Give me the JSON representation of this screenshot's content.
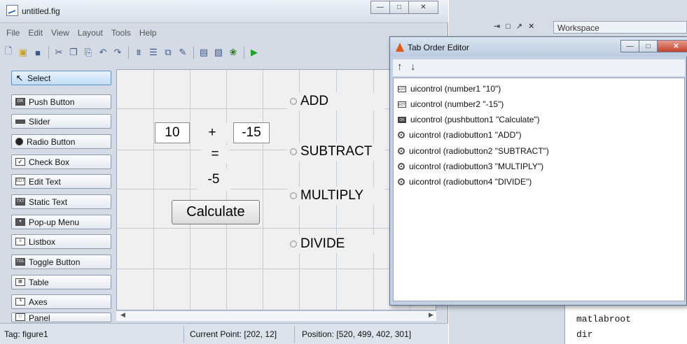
{
  "guide": {
    "title": "untitled.fig",
    "menu": [
      "File",
      "Edit",
      "View",
      "Layout",
      "Tools",
      "Help"
    ],
    "palette": [
      {
        "label": "Select",
        "icon": "arrow-cursor-icon"
      },
      {
        "label": "Push Button",
        "icon": "push-button-icon"
      },
      {
        "label": "Slider",
        "icon": "slider-icon"
      },
      {
        "label": "Radio Button",
        "icon": "radio-button-icon"
      },
      {
        "label": "Check Box",
        "icon": "check-box-icon"
      },
      {
        "label": "Edit Text",
        "icon": "edit-text-icon"
      },
      {
        "label": "Static Text",
        "icon": "static-text-icon"
      },
      {
        "label": "Pop-up Menu",
        "icon": "popup-menu-icon"
      },
      {
        "label": "Listbox",
        "icon": "listbox-icon"
      },
      {
        "label": "Toggle Button",
        "icon": "toggle-button-icon"
      },
      {
        "label": "Table",
        "icon": "table-icon"
      },
      {
        "label": "Axes",
        "icon": "axes-icon"
      },
      {
        "label": "Panel",
        "icon": "panel-icon"
      }
    ],
    "canvas": {
      "number1": "10",
      "plus": "+",
      "number2": "-15",
      "equals": "=",
      "result": "-5",
      "calculate": "Calculate",
      "radios": [
        "ADD",
        "SUBTRACT",
        "MULTIPLY",
        "DIVIDE"
      ]
    },
    "status": {
      "tag": "Tag: figure1",
      "current_point": "Current Point:  [202, 12]",
      "position": "Position: [520, 499, 402, 301]"
    }
  },
  "desktop": {
    "workspace_label": "Workspace",
    "command_history": [
      "matlabroot",
      "dir"
    ]
  },
  "tab_order_editor": {
    "title": "Tab Order Editor",
    "items": [
      {
        "text": "uicontrol (number1 \"10\")",
        "icon": "edit-text-icon"
      },
      {
        "text": "uicontrol (number2 \"-15\")",
        "icon": "edit-text-icon"
      },
      {
        "text": "uicontrol (pushbutton1 \"Calculate\")",
        "icon": "push-button-icon"
      },
      {
        "text": "uicontrol (radiobutton1 \"ADD\")",
        "icon": "radio-button-icon"
      },
      {
        "text": "uicontrol (radiobutton2 \"SUBTRACT\")",
        "icon": "radio-button-icon"
      },
      {
        "text": "uicontrol (radiobutton3 \"MULTIPLY\")",
        "icon": "radio-button-icon"
      },
      {
        "text": "uicontrol (radiobutton4 \"DIVIDE\")",
        "icon": "radio-button-icon"
      }
    ]
  }
}
